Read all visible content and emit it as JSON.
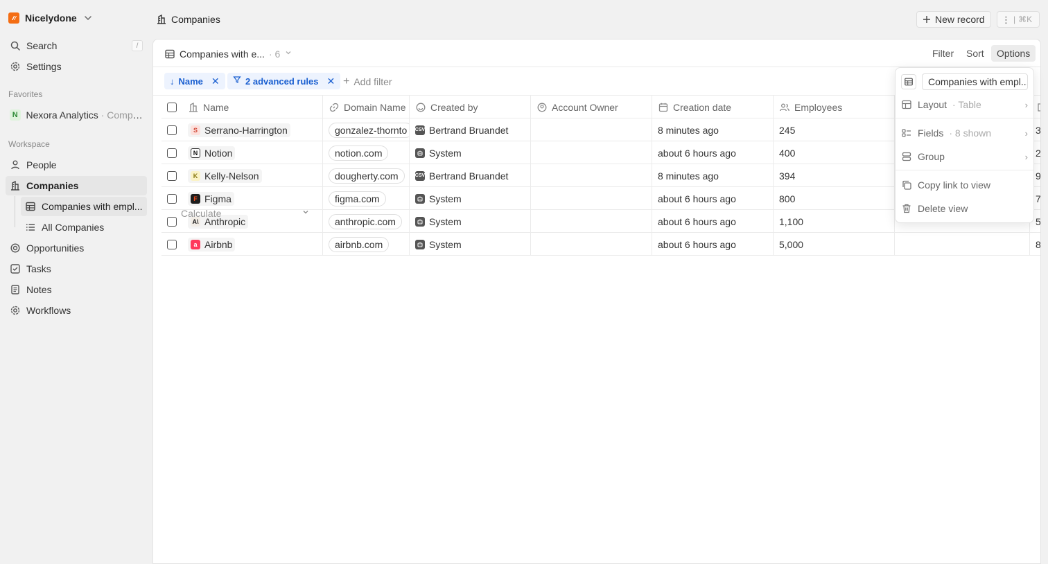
{
  "workspace": {
    "name": "Nicelydone"
  },
  "sidebar": {
    "search_label": "Search",
    "search_shortcut": "/",
    "settings_label": "Settings",
    "favorites_label": "Favorites",
    "favorite": {
      "badge": "N",
      "name": "Nexora Analytics",
      "sub": "· Compa..."
    },
    "workspace_label": "Workspace",
    "items": {
      "people": "People",
      "companies": "Companies",
      "companies_view": "Companies with empl...",
      "all_companies": "All Companies",
      "opportunities": "Opportunities",
      "tasks": "Tasks",
      "notes": "Notes",
      "workflows": "Workflows"
    }
  },
  "header": {
    "title": "Companies",
    "new_record_label": "New record",
    "shortcut_label": "⌘K"
  },
  "view_bar": {
    "view_name": "Companies with e...",
    "view_count": "· 6",
    "filter_label": "Filter",
    "sort_label": "Sort",
    "options_label": "Options"
  },
  "filters": {
    "sort_chip": "Name",
    "rules_chip": "2 advanced rules",
    "add_filter_label": "Add filter"
  },
  "table": {
    "columns": {
      "name": "Name",
      "domain": "Domain Name",
      "created_by": "Created by",
      "owner": "Account Owner",
      "date": "Creation date",
      "employees": "Employees"
    },
    "rows": [
      {
        "logo": "S",
        "name": "Serrano-Harrington",
        "domain": "gonzalez-thornto",
        "created_by": "Bertrand Bruandet",
        "creator_icon": "CSV",
        "date": "8 minutes ago",
        "employees": "245",
        "extra": "3"
      },
      {
        "logo": "N",
        "name": "Notion",
        "domain": "notion.com",
        "created_by": "System",
        "creator_icon": "bot",
        "date": "about 6 hours ago",
        "employees": "400",
        "extra": "2"
      },
      {
        "logo": "K",
        "name": "Kelly-Nelson",
        "domain": "dougherty.com",
        "created_by": "Bertrand Bruandet",
        "creator_icon": "CSV",
        "date": "8 minutes ago",
        "employees": "394",
        "extra": "9"
      },
      {
        "logo": "F",
        "name": "Figma",
        "domain": "figma.com",
        "created_by": "System",
        "creator_icon": "bot",
        "date": "about 6 hours ago",
        "employees": "800",
        "extra": "7"
      },
      {
        "logo": "A\\",
        "name": "Anthropic",
        "domain": "anthropic.com",
        "created_by": "System",
        "creator_icon": "bot",
        "date": "about 6 hours ago",
        "employees": "1,100",
        "extra": "5"
      },
      {
        "logo": "a",
        "name": "Airbnb",
        "domain": "airbnb.com",
        "created_by": "System",
        "creator_icon": "bot",
        "date": "about 6 hours ago",
        "employees": "5,000",
        "extra": "8"
      }
    ],
    "calculate_label": "Calculate"
  },
  "options_menu": {
    "view_name": "Companies with empl...",
    "layout_label": "Layout",
    "layout_value": "· Table",
    "fields_label": "Fields",
    "fields_value": "· 8 shown",
    "group_label": "Group",
    "copy_link_label": "Copy link to view",
    "delete_label": "Delete view"
  },
  "colors": {
    "brand": "#f46d13",
    "chip_bg": "#edf3fe",
    "chip_text": "#1a5fd0",
    "sidebar_bg": "#f1f1f1"
  }
}
